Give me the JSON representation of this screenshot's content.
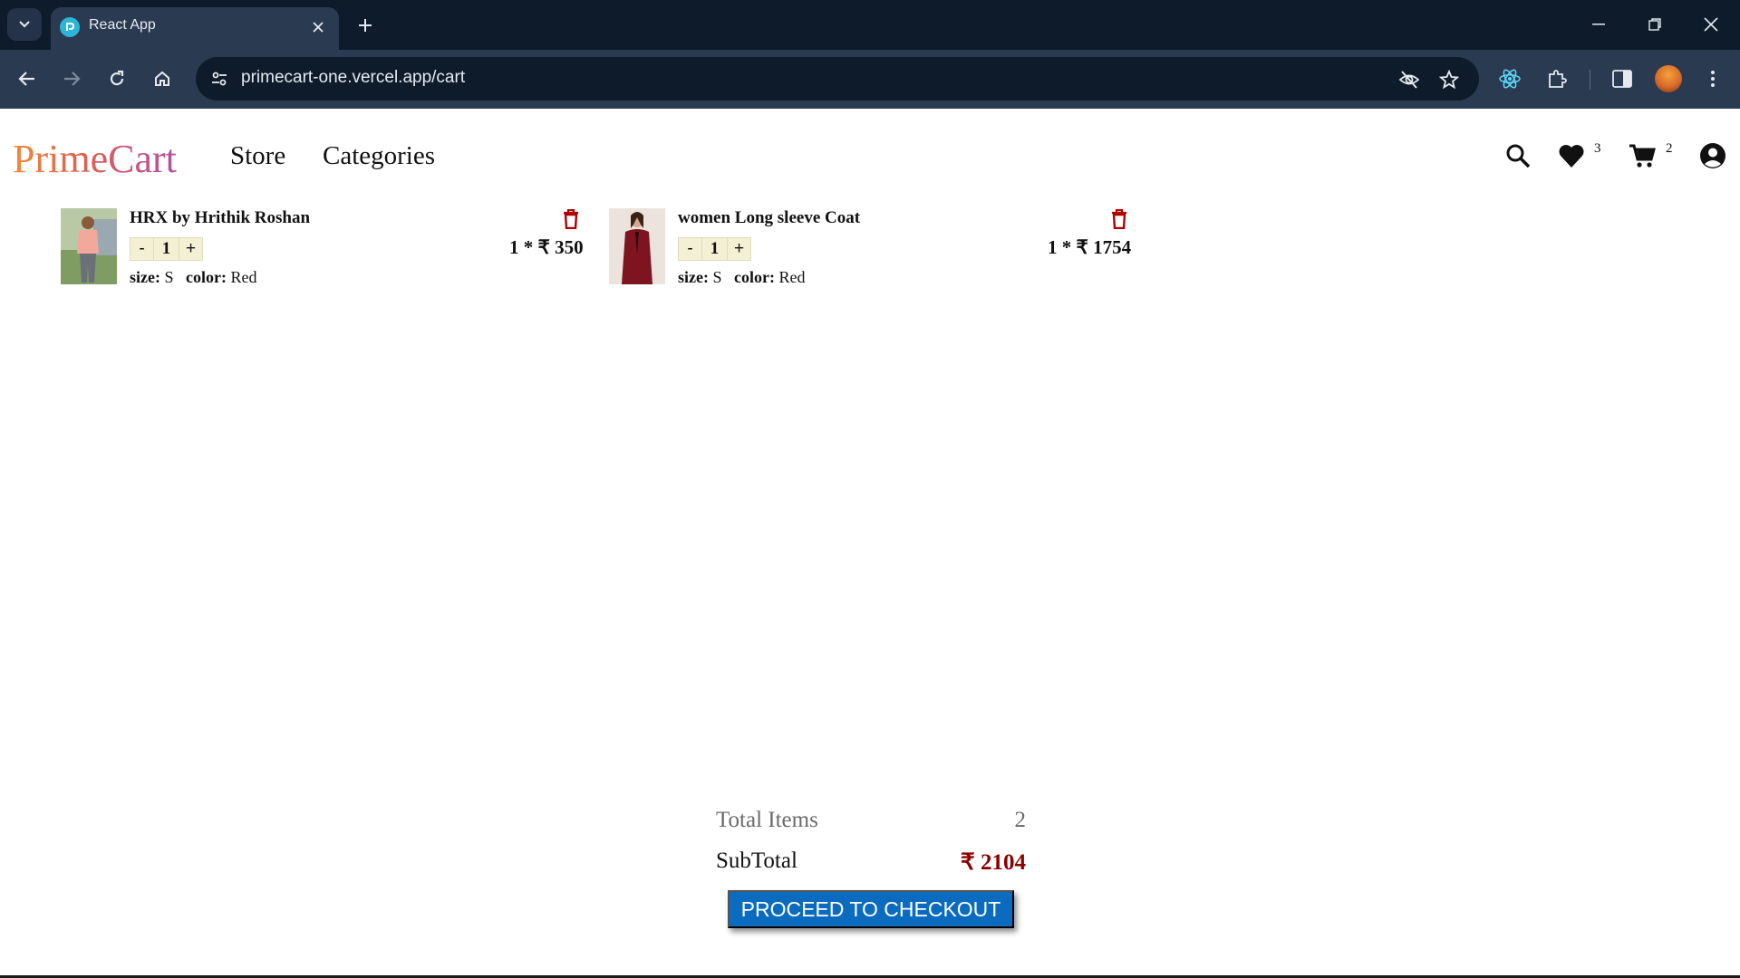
{
  "browser": {
    "tab_title": "React App",
    "url": "primecart-one.vercel.app/cart"
  },
  "header": {
    "logo": "PrimeCart",
    "nav": [
      "Store",
      "Categories"
    ],
    "wishlist_count": "3",
    "cart_count": "2"
  },
  "cart": {
    "items": [
      {
        "title": "HRX by Hrithik Roshan",
        "qty": "1",
        "minus": "-",
        "plus": "+",
        "size_label": "size:",
        "size": "S",
        "color_label": "color:",
        "color": "Red",
        "line_total": "1 * ₹ 350"
      },
      {
        "title": "women Long sleeve Coat",
        "qty": "1",
        "minus": "-",
        "plus": "+",
        "size_label": "size:",
        "size": "S",
        "color_label": "color:",
        "color": "Red",
        "line_total": "1 * ₹ 1754"
      }
    ]
  },
  "summary": {
    "total_items_label": "Total Items",
    "total_items": "2",
    "subtotal_label": "SubTotal",
    "subtotal": "₹ 2104",
    "checkout_label": "PROCEED TO CHECKOUT"
  },
  "colors": {
    "chrome_dark": "#0d1b2a",
    "chrome_toolbar": "#2a3a51",
    "trash": "#b00000",
    "subtotal": "#8b0000",
    "checkout": "#0a6bbf",
    "qty_bg": "#f4f0d4"
  },
  "icons": {
    "tab_list": "chevron-down-icon",
    "favicon": "react-app-favicon",
    "tab_close": "close-icon",
    "new_tab": "plus-icon",
    "back": "arrow-left-icon",
    "forward": "arrow-right-icon",
    "reload": "reload-icon",
    "home": "home-icon",
    "site_info": "tune-icon",
    "eye_off": "eye-off-icon",
    "bookmark": "star-icon",
    "react_devtools": "react-icon",
    "extensions": "puzzle-icon",
    "side_panel": "side-panel-icon",
    "menu": "kebab-menu-icon",
    "search": "search-icon",
    "wishlist": "heart-icon",
    "cart": "cart-icon",
    "account": "account-icon",
    "delete": "trash-icon"
  }
}
